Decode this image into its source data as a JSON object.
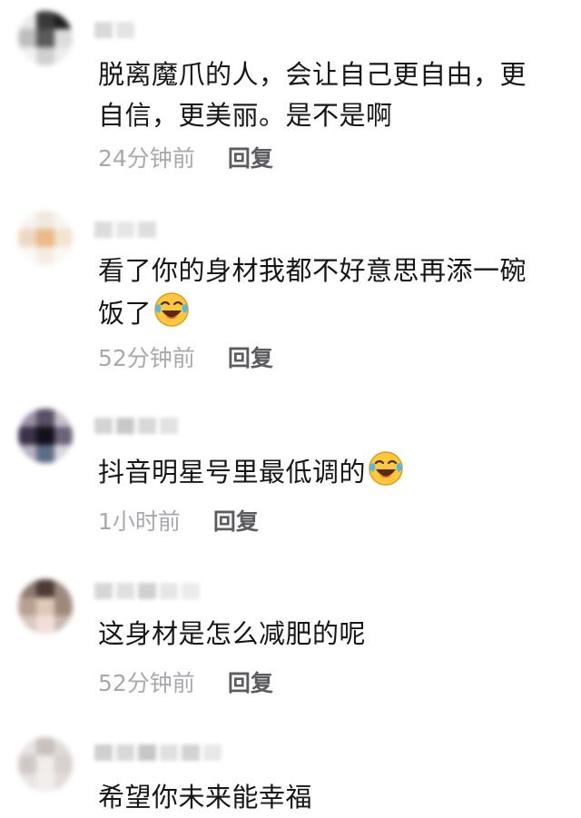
{
  "comments": [
    {
      "text": "脱离魔爪的人，会让自己更自由，更自信，更美丽。是不是啊",
      "time": "24分钟前",
      "reply_label": "回复",
      "emoji_icon": null,
      "avatar_colors": [
        "#e8e8e8",
        "#3a3a3a",
        "#1f1f1f",
        "#bdbdbd",
        "#5a5a5a",
        "#dcdcdc",
        "#f2f2f2",
        "#cfcfcf",
        "#ededed"
      ]
    },
    {
      "text": "看了你的身材我都不好意思再添一碗饭了",
      "time": "52分钟前",
      "reply_label": "回复",
      "emoji_icon": "laughing-crying-emoji",
      "avatar_colors": [
        "#f7f3ef",
        "#f1e9e0",
        "#f8f5f1",
        "#ecd9c3",
        "#e9b98a",
        "#f3e3d0",
        "#fbf8f4",
        "#f5ede4",
        "#fbf9f6"
      ]
    },
    {
      "text": "抖音明星号里最低调的",
      "time": "1小时前",
      "reply_label": "回复",
      "emoji_icon": "laughing-crying-emoji",
      "avatar_colors": [
        "#9a92a6",
        "#5a4f66",
        "#c6c0cc",
        "#3d3248",
        "#14101c",
        "#6d6279",
        "#b6b2c2",
        "#5d6c86",
        "#d9d6de"
      ]
    },
    {
      "text": "这身材是怎么减肥的呢",
      "time": "52分钟前",
      "reply_label": "回复",
      "emoji_icon": null,
      "avatar_colors": [
        "#8a7a70",
        "#4a3a32",
        "#9a8a80",
        "#b8a090",
        "#e0c8b8",
        "#a08878",
        "#d8c8c0",
        "#f0e0d8",
        "#c8b8b0"
      ]
    },
    {
      "text": "希望你未来能幸福",
      "time": "",
      "reply_label": "",
      "emoji_icon": null,
      "avatar_colors": [
        "#e6e2e0",
        "#c8c0bc",
        "#dedad8",
        "#d0c8c4",
        "#f0ecea",
        "#d8d0cc",
        "#e8e4e2",
        "#f2eeec",
        "#e0dcda"
      ]
    }
  ],
  "colors": {
    "text": "#161616",
    "time": "#a9a9ad",
    "reply": "#5c5c60",
    "background": "#ffffff"
  }
}
